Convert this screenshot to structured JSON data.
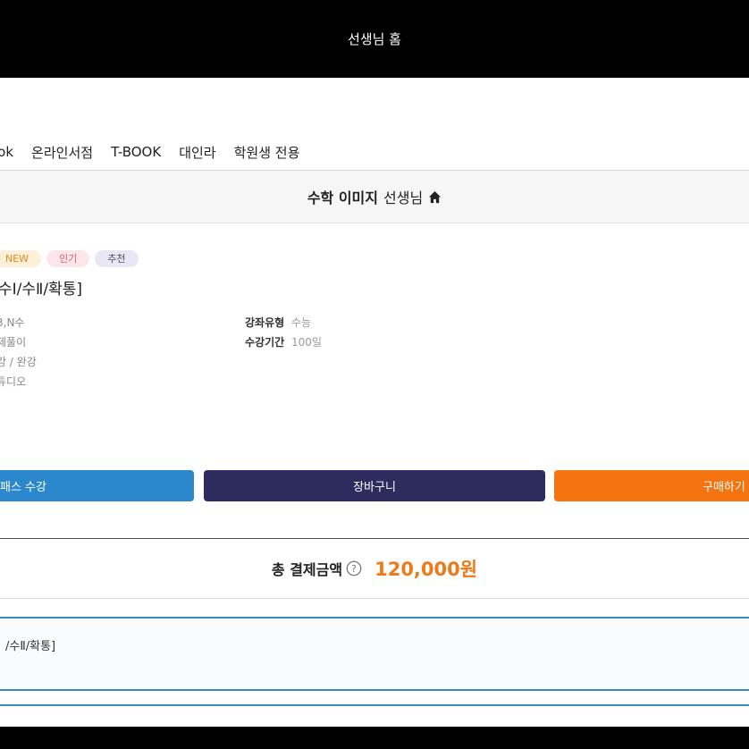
{
  "header": {
    "title": "선생님 홈"
  },
  "nav": {
    "items": [
      "ook",
      "온라인서점",
      "T-BOOK",
      "대인라",
      "학원생 전용"
    ]
  },
  "teacher": {
    "subject": "수학 이미지",
    "suffix": "선생님",
    "home_icon": "home-icon"
  },
  "badges": [
    "NEW",
    "인기",
    "추천"
  ],
  "course": {
    "title": "수Ⅰ/수Ⅱ/확통]"
  },
  "info_left": [
    "3,N수",
    "제풀이",
    "강 / 완강",
    "튜디오"
  ],
  "info_right": [
    {
      "label": "강좌유형",
      "value": "수능"
    },
    {
      "label": "수강기간",
      "value": "100일"
    }
  ],
  "buttons": {
    "pass": "패스 수강",
    "cart": "장바구니",
    "buy": "구매하기"
  },
  "total": {
    "label": "총 결제금액",
    "price": "120,000원",
    "help_icon": "question-icon"
  },
  "selected": {
    "text": "/수Ⅱ/확통]"
  },
  "selected2": {
    "text": "…"
  },
  "colors": {
    "pass": "#2c88cc",
    "cart": "#2e2c5e",
    "buy": "#f57410",
    "price": "#ee7a1a",
    "accent_border": "#3a88c2"
  }
}
